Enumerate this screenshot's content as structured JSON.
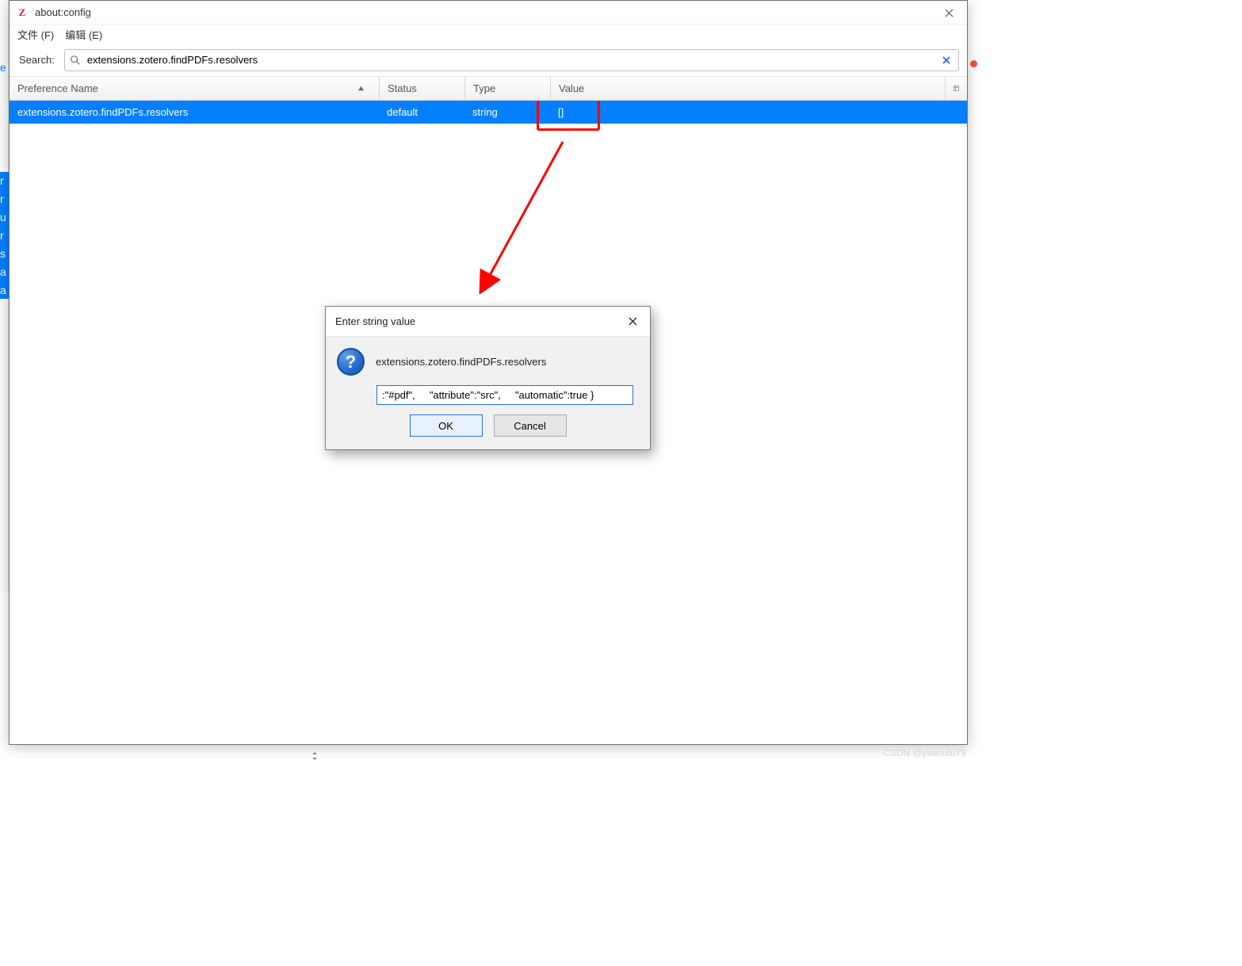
{
  "window": {
    "title": "about:config",
    "menu": {
      "file": "文件 (F)",
      "edit": "编辑 (E)"
    },
    "search": {
      "label": "Search:",
      "value": "extensions.zotero.findPDFs.resolvers"
    }
  },
  "columns": {
    "name": "Preference Name",
    "status": "Status",
    "type": "Type",
    "value": "Value"
  },
  "row": {
    "name": "extensions.zotero.findPDFs.resolvers",
    "status": "default",
    "type": "string",
    "value": "[]"
  },
  "dialog": {
    "title": "Enter string value",
    "pref_name": "extensions.zotero.findPDFs.resolvers",
    "input_value": ":\"#pdf\",     \"attribute\":\"src\",     \"automatic\":true }",
    "ok": "OK",
    "cancel": "Cancel"
  },
  "ghost_left": {
    "letters": [
      "r",
      "r",
      "u",
      "r",
      "s",
      "a",
      "a"
    ],
    "e_top": "e"
  },
  "watermark": "CSDN @yitahutu79"
}
